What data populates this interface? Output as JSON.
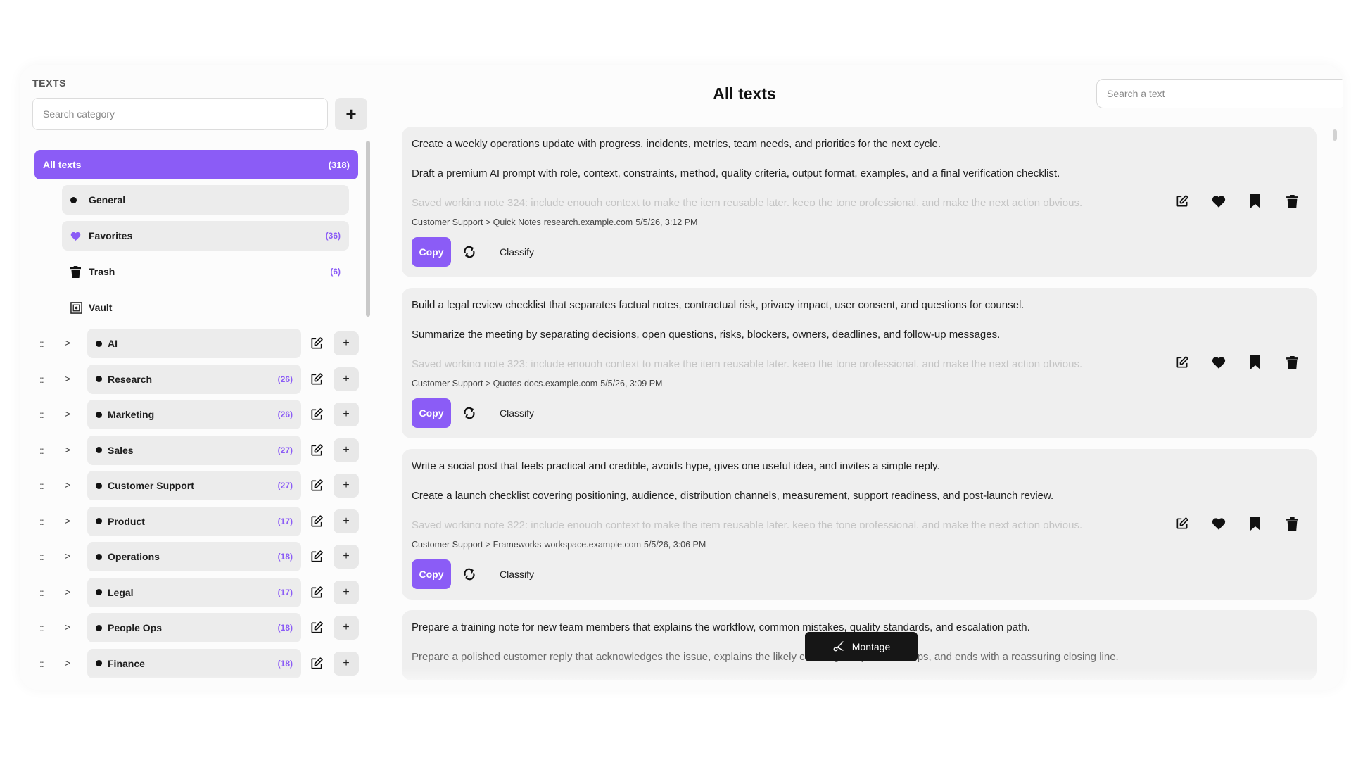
{
  "sidebar": {
    "heading": "TEXTS",
    "search_placeholder": "Search category",
    "add_label": "+",
    "all": {
      "label": "All texts",
      "count": "(318)"
    },
    "system": [
      {
        "label": "General",
        "count": "",
        "icon": "dot-icon"
      },
      {
        "label": "Favorites",
        "count": "(36)",
        "icon": "heart-icon"
      },
      {
        "label": "Trash",
        "count": "(6)",
        "icon": "trash-icon"
      },
      {
        "label": "Vault",
        "count": "",
        "icon": "vault-icon"
      }
    ],
    "categories": [
      {
        "label": "AI",
        "count": ""
      },
      {
        "label": "Research",
        "count": "(26)"
      },
      {
        "label": "Marketing",
        "count": "(26)"
      },
      {
        "label": "Sales",
        "count": "(27)"
      },
      {
        "label": "Customer Support",
        "count": "(27)"
      },
      {
        "label": "Product",
        "count": "(17)"
      },
      {
        "label": "Operations",
        "count": "(18)"
      },
      {
        "label": "Legal",
        "count": "(17)"
      },
      {
        "label": "People Ops",
        "count": "(18)"
      },
      {
        "label": "Finance",
        "count": "(18)"
      }
    ],
    "drag_glyph": "::",
    "chevron_glyph": ">",
    "row_add_glyph": "+"
  },
  "main": {
    "title": "All texts",
    "search_placeholder": "Search a text",
    "copy_label": "Copy",
    "classify_label": "Classify",
    "cards": [
      {
        "line1": "Create a weekly operations update with progress, incidents, metrics, team needs, and priorities for the next cycle.",
        "line2": "Draft a premium AI prompt with role, context, constraints, method, quality criteria, output format, examples, and a final verification checklist.",
        "line3": "Saved working note 324: include enough context to make the item reusable later, keep the tone professional, and make the next action obvious.",
        "path": "Customer Support > Quick Notes",
        "domain": "research.example.com",
        "date": "5/5/26, 3:12 PM"
      },
      {
        "line1": "Build a legal review checklist that separates factual notes, contractual risk, privacy impact, user consent, and questions for counsel.",
        "line2": "Summarize the meeting by separating decisions, open questions, risks, blockers, owners, deadlines, and follow-up messages.",
        "line3": "Saved working note 323: include enough context to make the item reusable later, keep the tone professional, and make the next action obvious.",
        "path": "Customer Support > Quotes",
        "domain": "docs.example.com",
        "date": "5/5/26, 3:09 PM"
      },
      {
        "line1": "Write a social post that feels practical and credible, avoids hype, gives one useful idea, and invites a simple reply.",
        "line2": "Create a launch checklist covering positioning, audience, distribution channels, measurement, support readiness, and post-launch review.",
        "line3": "Saved working note 322: include enough context to make the item reusable later, keep the tone professional, and make the next action obvious.",
        "path": "Customer Support > Frameworks",
        "domain": "workspace.example.com",
        "date": "5/5/26, 3:06 PM"
      },
      {
        "line1": "Prepare a training note for new team members that explains the workflow, common mistakes, quality standards, and escalation path.",
        "line2": "Prepare a polished customer reply that acknowledges the issue, explains the likely cause, gives practical steps, and ends with a reassuring closing line."
      }
    ],
    "toast": {
      "label": "Montage",
      "icon": "scissors-icon"
    }
  },
  "colors": {
    "accent": "#8b5cf6",
    "pill": "#ececec",
    "card": "#efefef",
    "toast": "#161616"
  }
}
